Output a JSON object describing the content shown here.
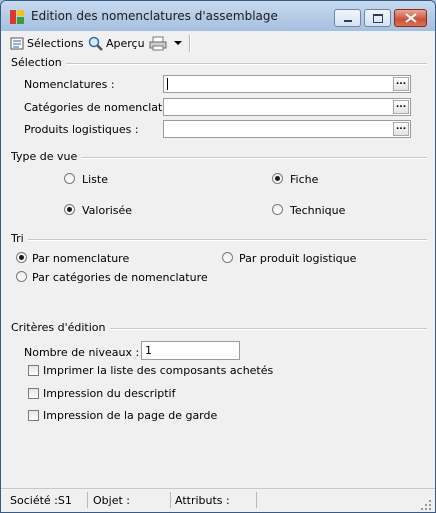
{
  "window": {
    "title": "Edition des nomenclatures d'assemblage",
    "minimize_label": "—",
    "maximize_label": "□",
    "close_label": "✕"
  },
  "toolbar": {
    "selections_label": "Sélections",
    "preview_label": "Aperçu",
    "print_dropdown_label": "▾"
  },
  "selection": {
    "title": "Sélection",
    "fields": [
      {
        "label": "Nomenclatures :",
        "value": ""
      },
      {
        "label": "Catégories de nomenclature :",
        "value": ""
      },
      {
        "label": "Produits logistiques :",
        "value": ""
      }
    ],
    "browse_label": "..."
  },
  "view_type": {
    "title": "Type de vue",
    "options": [
      {
        "label": "Liste",
        "selected": false
      },
      {
        "label": "Fiche",
        "selected": true
      },
      {
        "label": "Valorisée",
        "selected": true
      },
      {
        "label": "Technique",
        "selected": false
      }
    ]
  },
  "sort": {
    "title": "Tri",
    "options": [
      {
        "label": "Par nomenclature",
        "selected": true
      },
      {
        "label": "Par produit logistique",
        "selected": false
      },
      {
        "label": "Par catégories de nomenclature",
        "selected": false
      }
    ]
  },
  "criteria": {
    "title": "Critères d'édition",
    "levels_label": "Nombre de niveaux :",
    "levels_value": "1",
    "checkboxes": [
      {
        "label": "Imprimer la liste des composants achetés",
        "checked": false
      },
      {
        "label": "Impression du descriptif",
        "checked": false
      },
      {
        "label": "Impression de la page de garde",
        "checked": false
      }
    ]
  },
  "statusbar": {
    "company": "Société :S1",
    "object": "Objet :",
    "attributes": "Attributs :"
  }
}
